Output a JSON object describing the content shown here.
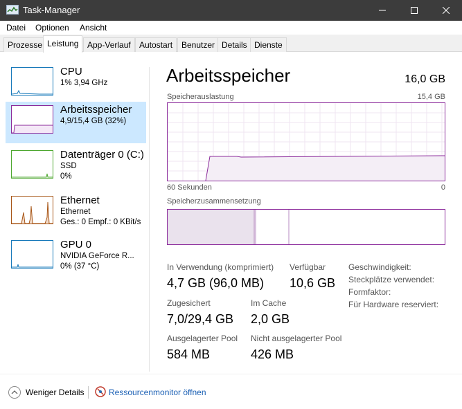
{
  "window": {
    "title": "Task-Manager"
  },
  "menu": [
    "Datei",
    "Optionen",
    "Ansicht"
  ],
  "tabs": [
    "Prozesse",
    "Leistung",
    "App-Verlauf",
    "Autostart",
    "Benutzer",
    "Details",
    "Dienste"
  ],
  "active_tab": "Leistung",
  "resources": [
    {
      "name": "CPU",
      "line1": "1% 3,94 GHz",
      "line2": "",
      "color": "#1779ba"
    },
    {
      "name": "Arbeitsspeicher",
      "line1": "4,9/15,4 GB (32%)",
      "line2": "",
      "color": "#8b2a9b"
    },
    {
      "name": "Datenträger 0 (C:)",
      "line1": "SSD",
      "line2": "0%",
      "color": "#4da72f"
    },
    {
      "name": "Ethernet",
      "line1": "Ethernet",
      "line2": "Ges.: 0 Empf.: 0 KBit/s",
      "color": "#a75516"
    },
    {
      "name": "GPU 0",
      "line1": "NVIDIA GeForce R...",
      "line2": "0% (37 °C)",
      "color": "#1779ba"
    }
  ],
  "detail": {
    "title": "Arbeitsspeicher",
    "total": "16,0 GB",
    "usage_label": "Speicherauslastung",
    "usage_max": "15,4 GB",
    "time_left": "60 Sekunden",
    "time_right": "0",
    "composition_label": "Speicherzusammensetzung",
    "usage_percent": 32,
    "stats": {
      "in_use_label": "In Verwendung (komprimiert)",
      "in_use_value": "4,7 GB (96,0 MB)",
      "available_label": "Verfügbar",
      "available_value": "10,6 GB",
      "committed_label": "Zugesichert",
      "committed_value": "7,0/29,4 GB",
      "cached_label": "Im Cache",
      "cached_value": "2,0 GB",
      "paged_label": "Ausgelagerter Pool",
      "paged_value": "584 MB",
      "nonpaged_label": "Nicht ausgelagerter Pool",
      "nonpaged_value": "426 MB"
    },
    "side": {
      "speed_label": "Geschwindigkeit:",
      "slots_label": "Steckplätze verwendet:",
      "form_label": "Formfaktor:",
      "reserved_label": "Für Hardware reserviert:"
    }
  },
  "footer": {
    "fewer_details": "Weniger Details",
    "resource_monitor": "Ressourcenmonitor öffnen"
  }
}
